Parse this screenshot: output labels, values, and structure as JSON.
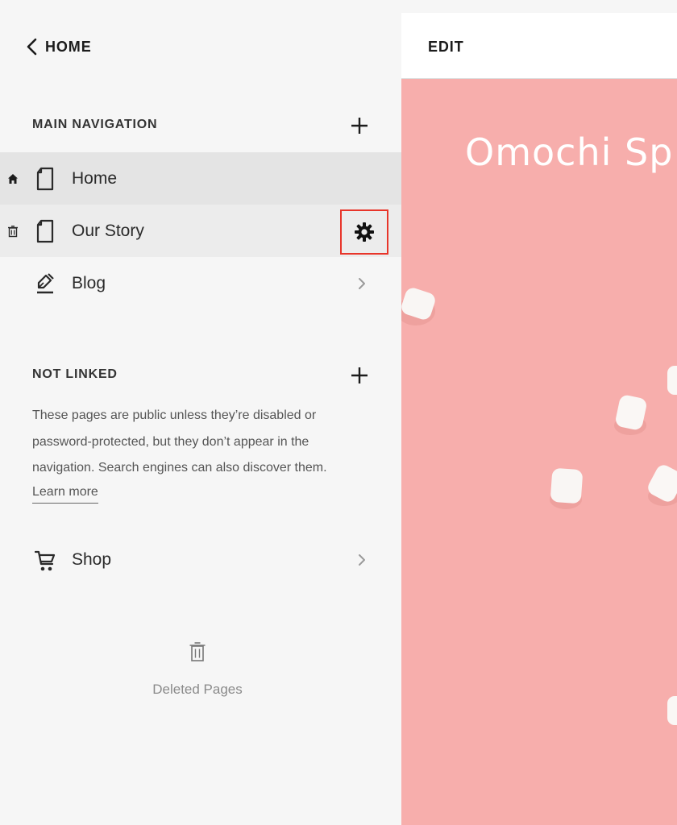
{
  "nav": {
    "back_label": "HOME"
  },
  "main_navigation": {
    "title": "MAIN NAVIGATION",
    "items": [
      {
        "label": "Home",
        "icon": "page-icon",
        "side_icon": "home-icon"
      },
      {
        "label": "Our Story",
        "icon": "page-icon",
        "side_icon": "trash-icon"
      },
      {
        "label": "Blog",
        "icon": "blog-pen-icon"
      }
    ]
  },
  "not_linked": {
    "title": "NOT LINKED",
    "description": "These pages are public unless they’re disabled or password-protected, but they don’t appear in the navigation. Search engines can also discover them.",
    "learn_more": "Learn more",
    "items": [
      {
        "label": "Shop",
        "icon": "cart-icon"
      }
    ]
  },
  "deleted": {
    "label": "Deleted Pages"
  },
  "preview": {
    "edit_label": "EDIT",
    "hero_title": "Omochi Sp",
    "background_color": "#f7aeac"
  },
  "colors": {
    "highlight_border": "#e8352a",
    "selected_row": "#e4e4e4",
    "hover_row": "#ececec"
  }
}
